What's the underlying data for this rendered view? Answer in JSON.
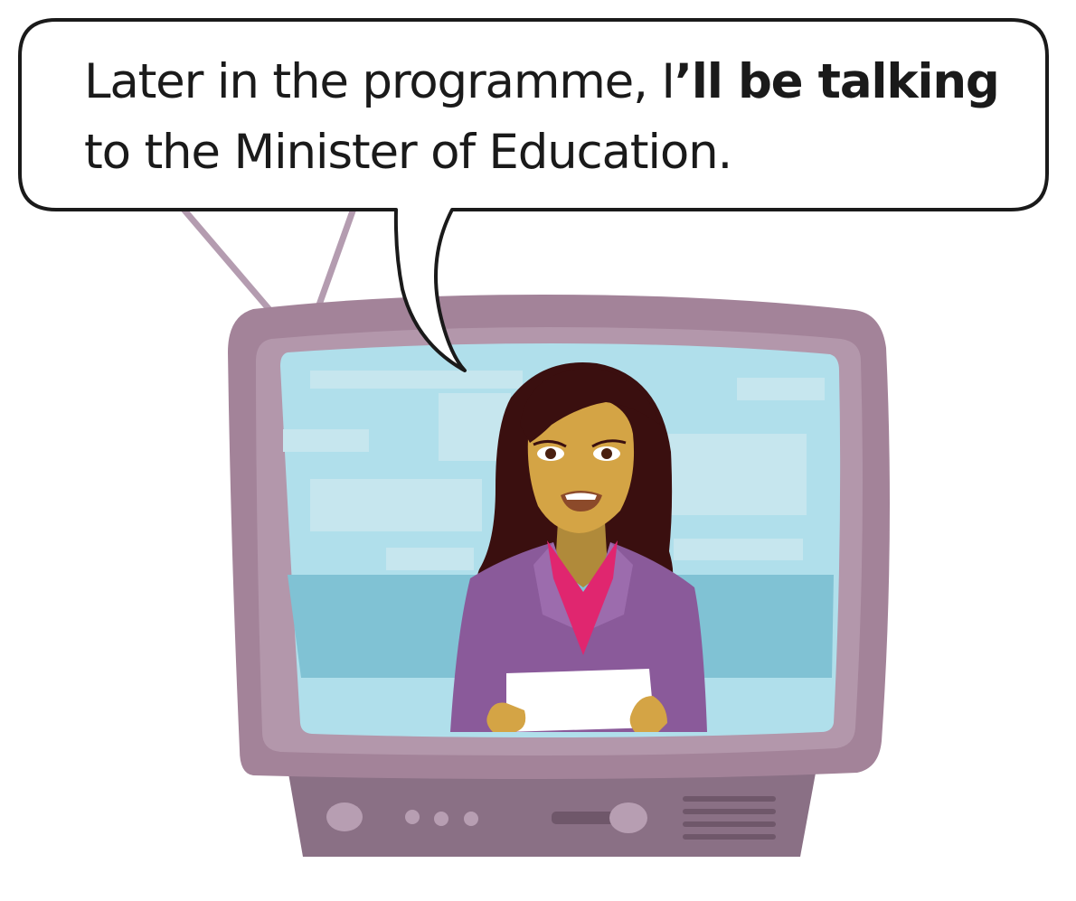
{
  "speech_bubble": {
    "line1_plain": "Later in the programme, I",
    "line1_bold": "’ll be talking",
    "line2": "to the Minister of Education."
  },
  "colors": {
    "tv_body": "#a38399",
    "tv_bezel": "#b397ab",
    "tv_base": "#8a7085",
    "screen": "#b0dfeb",
    "screen_band": "#80c2d4",
    "jacket": "#8a5a9a",
    "skin": "#d4a445",
    "hair": "#3a0f0f",
    "blouse": "#e0266f"
  },
  "icons": [
    "television-icon",
    "newsreader-figure",
    "antenna-icon",
    "speech-bubble"
  ]
}
